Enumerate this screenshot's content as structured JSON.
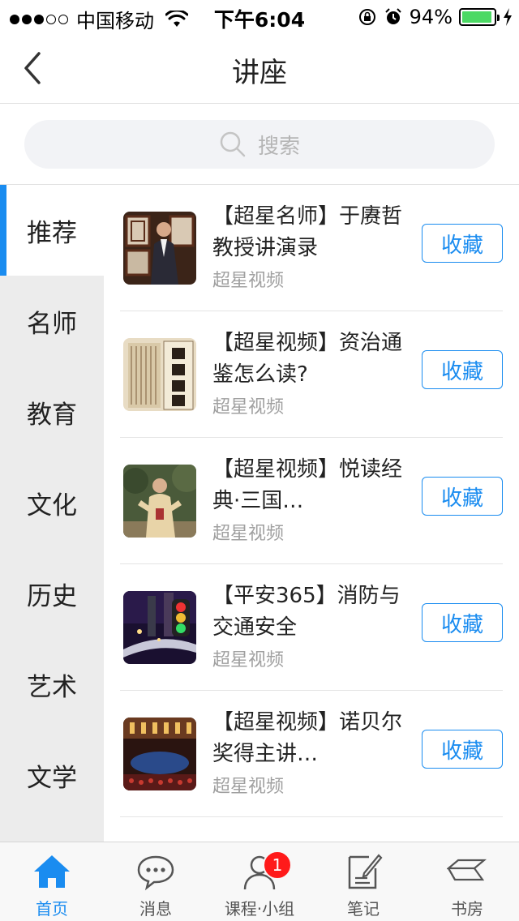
{
  "status_bar": {
    "carrier": "中国移动",
    "time": "下午6:04",
    "battery": "94%",
    "battery_level": 0.94
  },
  "nav": {
    "title": "讲座",
    "back_icon": "chevron-left-icon"
  },
  "search": {
    "placeholder": "搜索"
  },
  "sidebar": {
    "items": [
      {
        "label": "推荐",
        "active": true
      },
      {
        "label": "名师",
        "active": false
      },
      {
        "label": "教育",
        "active": false
      },
      {
        "label": "文化",
        "active": false
      },
      {
        "label": "历史",
        "active": false
      },
      {
        "label": "艺术",
        "active": false
      },
      {
        "label": "文学",
        "active": false
      }
    ]
  },
  "list": {
    "items": [
      {
        "title": "【超星名师】于赓哲教授讲演录",
        "source": "超星视频",
        "button": "收藏"
      },
      {
        "title": "【超星视频】资治通鉴怎么读?",
        "source": "超星视频",
        "button": "收藏"
      },
      {
        "title": "【超星视频】悦读经典·三国…",
        "source": "超星视频",
        "button": "收藏"
      },
      {
        "title": "【平安365】消防与交通安全",
        "source": "超星视频",
        "button": "收藏"
      },
      {
        "title": "【超星视频】诺贝尔奖得主讲…",
        "source": "超星视频",
        "button": "收藏"
      }
    ]
  },
  "tabbar": {
    "tabs": [
      {
        "label": "首页",
        "icon": "home-icon",
        "active": true
      },
      {
        "label": "消息",
        "icon": "chat-icon",
        "active": false
      },
      {
        "label": "课程·小组",
        "icon": "person-icon",
        "active": false,
        "badge": "1"
      },
      {
        "label": "笔记",
        "icon": "note-icon",
        "active": false
      },
      {
        "label": "书房",
        "icon": "books-icon",
        "active": false
      }
    ]
  },
  "colors": {
    "accent": "#1a8cf0",
    "badge": "#ff1a1a",
    "sidebar_bg": "#ececec"
  }
}
